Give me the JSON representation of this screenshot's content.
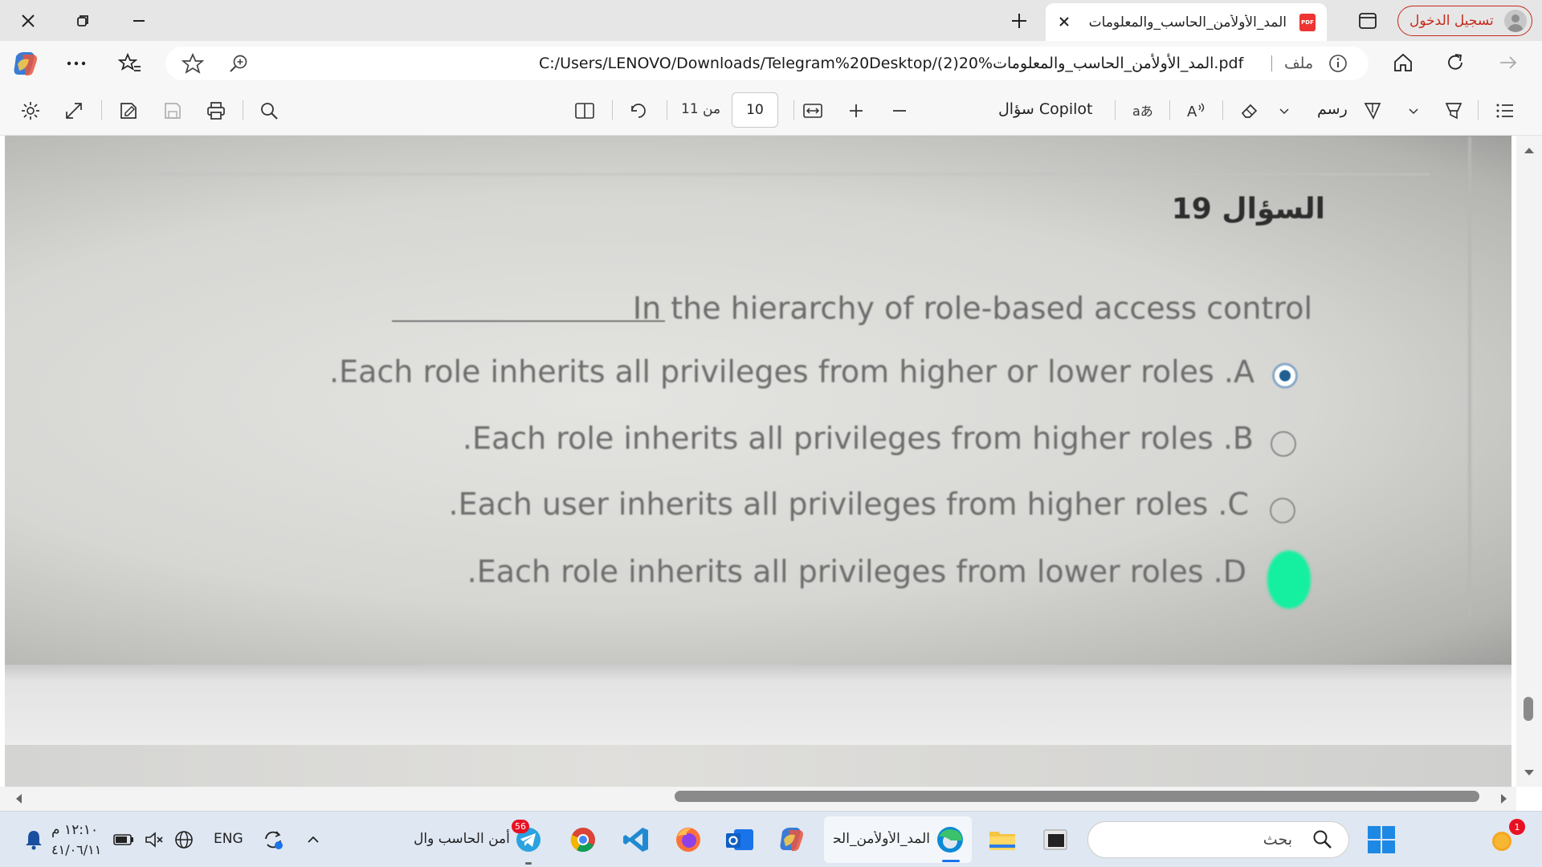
{
  "browser": {
    "tab_title": "المد_الأولأمن_الحاسب_والمعلومات (",
    "signin_label": "تسجيل الدخول",
    "url": "C:/Users/LENOVO/Downloads/Telegram%20Desktop/(2)20%المد_الأولأمن_الحاسب_والمعلومات.pdf",
    "file_label": "ملف"
  },
  "pdf_toolbar": {
    "page_current": "10",
    "page_of": "من 11",
    "copilot_label": "سؤال Copilot",
    "draw_label": "رسم"
  },
  "question": {
    "title": "السؤال 19",
    "text": "In the hierarchy of role-based access control",
    "options": [
      {
        "text": ".Each role inherits all privileges from higher or lower roles .A",
        "selected": true
      },
      {
        "text": ".Each role inherits all privileges from higher roles .B",
        "selected": false
      },
      {
        "text": ".Each user inherits all privileges from higher roles .C",
        "selected": false
      },
      {
        "text": ".Each role inherits all privileges from lower roles .D",
        "selected": false,
        "highlight": "#14f0a0"
      }
    ]
  },
  "taskbar": {
    "search_label": "بحث",
    "edge_label": "المد_الأولأمن_الحا",
    "telegram_label": "أمن الحاسب وال",
    "telegram_badge": "56",
    "widgets_badge": "1",
    "language": "ENG",
    "time": "١٢:١٠ م",
    "date": "٤١/٠٦/١١"
  },
  "colors": {
    "accent_red": "#c42b1c",
    "radio_selected": "#1f5f92",
    "answer_highlight": "#14f0a0"
  }
}
